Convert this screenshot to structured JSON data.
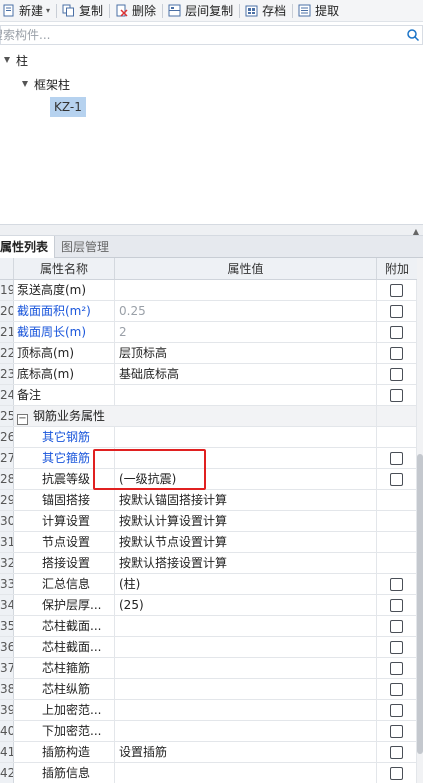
{
  "toolbar": {
    "new_label": "新建",
    "copy_label": "复制",
    "delete_label": "删除",
    "floor_copy_label": "层间复制",
    "archive_label": "存档",
    "extract_label": "提取"
  },
  "search": {
    "placeholder": "搜索构件..."
  },
  "tree": {
    "root": "柱",
    "child": "框架柱",
    "leaf": "KZ-1"
  },
  "tabs": {
    "attr_list": "属性列表",
    "layer_mgmt": "图层管理"
  },
  "table": {
    "headers": {
      "name": "属性名称",
      "value": "属性值",
      "extra": "附加"
    },
    "rows": [
      {
        "num": "19",
        "name": "泵送高度(m)",
        "value": ""
      },
      {
        "num": "20",
        "name": "截面面积(m²)",
        "value": "0.25"
      },
      {
        "num": "21",
        "name": "截面周长(m)",
        "value": "2"
      },
      {
        "num": "22",
        "name": "顶标高(m)",
        "value": "层顶标高"
      },
      {
        "num": "23",
        "name": "底标高(m)",
        "value": "基础底标高"
      },
      {
        "num": "24",
        "name": "备注",
        "value": ""
      },
      {
        "num": "25",
        "name": "钢筋业务属性",
        "value": ""
      },
      {
        "num": "26",
        "name": "其它钢筋",
        "value": ""
      },
      {
        "num": "27",
        "name": "其它箍筋",
        "value": ""
      },
      {
        "num": "28",
        "name": "抗震等级",
        "value": "(一级抗震)"
      },
      {
        "num": "29",
        "name": "锚固搭接",
        "value": "按默认锚固搭接计算"
      },
      {
        "num": "30",
        "name": "计算设置",
        "value": "按默认计算设置计算"
      },
      {
        "num": "31",
        "name": "节点设置",
        "value": "按默认节点设置计算"
      },
      {
        "num": "32",
        "name": "搭接设置",
        "value": "按默认搭接设置计算"
      },
      {
        "num": "33",
        "name": "汇总信息",
        "value": "(柱)"
      },
      {
        "num": "34",
        "name": "保护层厚...",
        "value": "(25)"
      },
      {
        "num": "35",
        "name": "芯柱截面...",
        "value": ""
      },
      {
        "num": "36",
        "name": "芯柱截面...",
        "value": ""
      },
      {
        "num": "37",
        "name": "芯柱箍筋",
        "value": ""
      },
      {
        "num": "38",
        "name": "芯柱纵筋",
        "value": ""
      },
      {
        "num": "39",
        "name": "上加密范...",
        "value": ""
      },
      {
        "num": "40",
        "name": "下加密范...",
        "value": ""
      },
      {
        "num": "41",
        "name": "插筋构造",
        "value": "设置插筋"
      },
      {
        "num": "42",
        "name": "插筋信息",
        "value": ""
      }
    ]
  },
  "colors": {
    "highlight": "#e02020",
    "link_blue": "#1a56db",
    "selection": "#b6d2ef"
  }
}
